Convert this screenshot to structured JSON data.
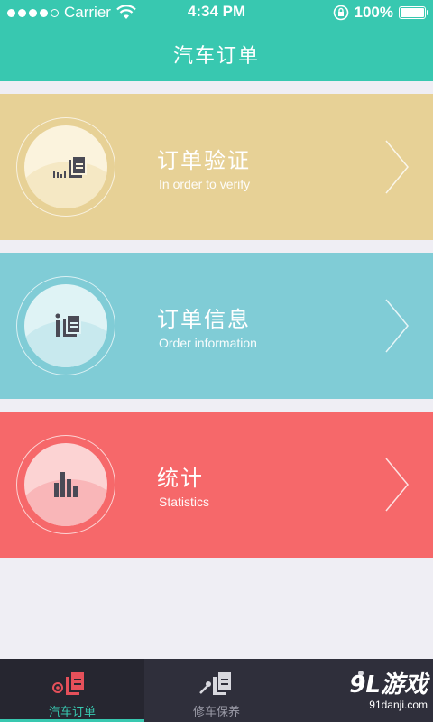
{
  "status_bar": {
    "carrier": "Carrier",
    "time": "4:34 PM",
    "battery": "100%",
    "battery_level": 1.0,
    "signal_bars": 5
  },
  "header": {
    "title": "汽车订单",
    "color": "#38c8b0"
  },
  "cards": [
    {
      "title": "订单验证",
      "subtitle": "In order to verify",
      "color": "#e7d196",
      "icon": "order-verify-icon"
    },
    {
      "title": "订单信息",
      "subtitle": "Order information",
      "color": "#80ccd6",
      "icon": "order-info-icon"
    },
    {
      "title": "统计",
      "subtitle": "Statistics",
      "color": "#f6686a",
      "icon": "statistics-icon"
    }
  ],
  "tabbar": {
    "active_color": "#38c8b0",
    "tabs": [
      {
        "label": "汽车订单",
        "icon": "car-order-icon",
        "active": true
      },
      {
        "label": "修车保养",
        "icon": "repair-icon",
        "active": false
      },
      {
        "label": "",
        "icon": "third-tab-icon",
        "active": false
      }
    ]
  },
  "watermark": {
    "main": "9L游戏",
    "sub": "91danji.com"
  }
}
